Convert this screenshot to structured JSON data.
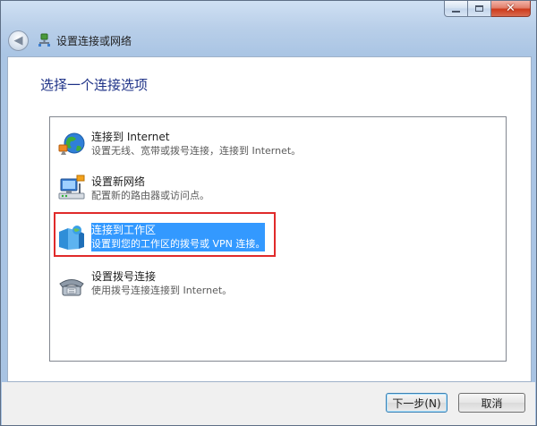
{
  "window": {
    "title": "设置连接或网络",
    "close_glyph": "✕",
    "back_glyph": "◀"
  },
  "main": {
    "heading": "选择一个连接选项",
    "options": [
      {
        "title": "连接到 Internet",
        "description": "设置无线、宽带或拨号连接，连接到 Internet。",
        "icon": "globe-network-icon",
        "selected": false
      },
      {
        "title": "设置新网络",
        "description": "配置新的路由器或访问点。",
        "icon": "router-icon",
        "selected": false
      },
      {
        "title": "连接到工作区",
        "description": "设置到您的工作区的拨号或 VPN 连接。",
        "icon": "workplace-building-icon",
        "selected": true
      },
      {
        "title": "设置拨号连接",
        "description": "使用拨号连接连接到 Internet。",
        "icon": "telephone-icon",
        "selected": false
      }
    ]
  },
  "footer": {
    "next_label": "下一步(N)",
    "cancel_label": "取消"
  },
  "colors": {
    "selection": "#3399ff",
    "annotation_border": "#e02a2a",
    "heading": "#1e3287"
  }
}
